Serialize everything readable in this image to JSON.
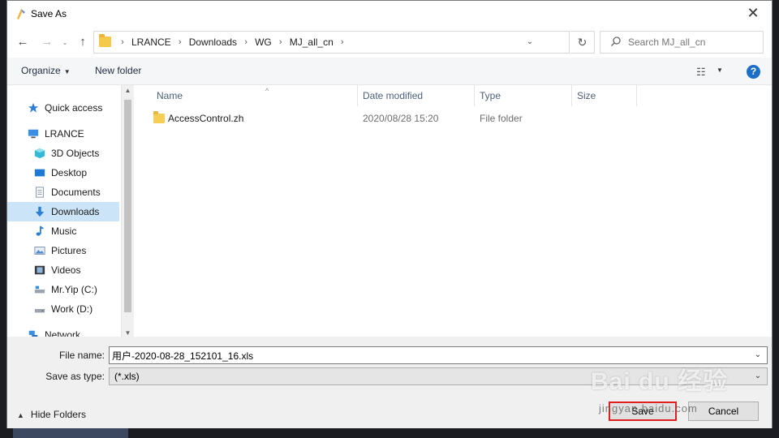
{
  "window": {
    "title": "Save As",
    "close_glyph": "✕"
  },
  "nav": {
    "back_glyph": "←",
    "forward_glyph": "→",
    "recent_glyph": "⌄",
    "up_glyph": "↑",
    "breadcrumbs": [
      "LRANCE",
      "Downloads",
      "WG",
      "MJ_all_cn"
    ],
    "sep_glyph": "›",
    "dropdown_glyph": "⌄",
    "refresh_glyph": "↻"
  },
  "search": {
    "placeholder": "Search MJ_all_cn",
    "icon": "search-icon"
  },
  "toolbar": {
    "organize_label": "Organize",
    "new_folder_label": "New folder",
    "arrow_glyph": "▼",
    "view_glyph": "☷",
    "help_glyph": "?"
  },
  "sidebar": {
    "items": [
      {
        "label": "Quick access",
        "icon": "star-icon",
        "selected": false
      },
      {
        "label": "LRANCE",
        "icon": "computer-icon",
        "selected": false
      },
      {
        "label": "3D Objects",
        "icon": "cube-icon",
        "selected": false
      },
      {
        "label": "Desktop",
        "icon": "desktop-icon",
        "selected": false
      },
      {
        "label": "Documents",
        "icon": "document-icon",
        "selected": false
      },
      {
        "label": "Downloads",
        "icon": "download-icon",
        "selected": true
      },
      {
        "label": "Music",
        "icon": "music-icon",
        "selected": false
      },
      {
        "label": "Pictures",
        "icon": "picture-icon",
        "selected": false
      },
      {
        "label": "Videos",
        "icon": "video-icon",
        "selected": false
      },
      {
        "label": "Mr.Yip (C:)",
        "icon": "drive-icon",
        "selected": false
      },
      {
        "label": "Work (D:)",
        "icon": "drive-icon",
        "selected": false
      },
      {
        "label": "Network",
        "icon": "network-icon",
        "selected": false
      }
    ],
    "scroll_up_glyph": "▲",
    "scroll_down_glyph": "▼"
  },
  "filelist": {
    "columns": [
      "Name",
      "Date modified",
      "Type",
      "Size"
    ],
    "sort_glyph": "^",
    "rows": [
      {
        "name": "AccessControl.zh",
        "date": "2020/08/28 15:20",
        "type": "File folder",
        "size": ""
      }
    ]
  },
  "form": {
    "file_name_label": "File name:",
    "file_name_value": "用户-2020-08-28_152101_16.xls",
    "save_type_label": "Save as type:",
    "save_type_value": "(*.xls)",
    "combo_glyph": "⌄"
  },
  "footer": {
    "hide_folders_label": "Hide Folders",
    "hide_glyph": "▲",
    "save_label": "Save",
    "cancel_label": "Cancel"
  },
  "watermark": {
    "text": "Bai du 经验",
    "sub": "jingyan.baidu.com"
  },
  "colors": {
    "accent": "#1c6ec7",
    "selection": "#cce4f7",
    "highlight_border": "#e0201e",
    "folder": "#f5c94a"
  }
}
